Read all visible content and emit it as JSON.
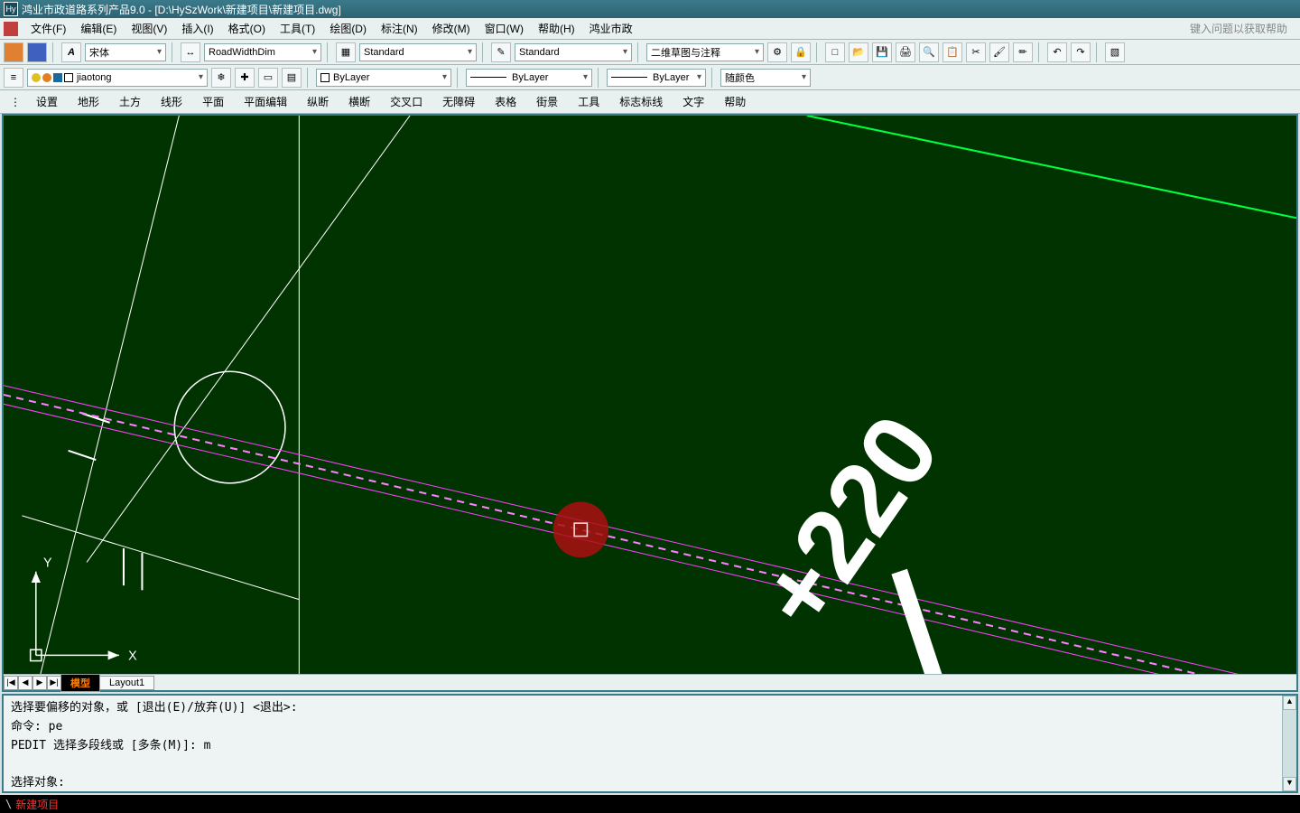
{
  "title": "鸿业市政道路系列产品9.0  - [D:\\HySzWork\\新建项目\\新建项目.dwg]",
  "menu": {
    "items": [
      "文件(F)",
      "编辑(E)",
      "视图(V)",
      "插入(I)",
      "格式(O)",
      "工具(T)",
      "绘图(D)",
      "标注(N)",
      "修改(M)",
      "窗口(W)",
      "帮助(H)",
      "鸿业市政"
    ],
    "help_prompt": "键入问题以获取帮助"
  },
  "toolbar1": {
    "font_btn_label": "A",
    "font": "宋体",
    "dim_style": "RoadWidthDim",
    "text_style": "Standard",
    "table_style": "Standard",
    "view_mode": "二维草图与注释"
  },
  "toolbar2": {
    "layer_name": "jiaotong",
    "linetype": "ByLayer",
    "lineweight": "ByLayer",
    "plotstyle": "ByLayer",
    "color_label": "随颜色"
  },
  "sub_tabs": [
    "设置",
    "地形",
    "土方",
    "线形",
    "平面",
    "平面编辑",
    "纵断",
    "横断",
    "交叉口",
    "无障碍",
    "表格",
    "街景",
    "工具",
    "标志标线",
    "文字",
    "帮助"
  ],
  "canvas": {
    "station_text": "+220",
    "axis_x": "X",
    "axis_y": "Y"
  },
  "layout_tabs": {
    "nav": [
      "|◀",
      "◀",
      "▶",
      "▶|"
    ],
    "model": "模型",
    "layout1": "Layout1"
  },
  "command": {
    "line1": "选择要偏移的对象，或 [退出(E)/放弃(U)] <退出>:",
    "line2": "命令: pe",
    "line3": "PEDIT 选择多段线或 [多条(M)]: m",
    "line4": "",
    "line5": "选择对象:"
  },
  "status": {
    "seg1": "\\",
    "seg2": "新建项目"
  }
}
